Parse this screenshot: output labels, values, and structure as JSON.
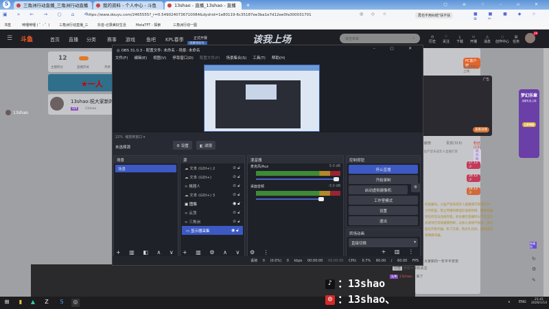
{
  "browser": {
    "tabs": [
      {
        "label": "三角洲行动直播_三角洲行动直播"
      },
      {
        "label": "我的资料 - 个人中心 - 斗鱼"
      },
      {
        "label": "13shao - 直播_13shao - 直播"
      }
    ],
    "new_tab": "+",
    "url": "https://www.douyu.com/2465555?_r=0.5490240736710084&dyshid=1e80119-6c35187ee3ba1e7d12ee0fa300031701",
    "notice": "再也不用纠结\"扶不扶",
    "bookmarks": [
      "书签",
      "啤哩啤哩 ( ゜- ゜)",
      "三角洲行动直播_三",
      "抖音-记录美好生活",
      "MetaTFT - 探索",
      "三角洲行动一图"
    ]
  },
  "site": {
    "logo": "斗鱼",
    "nav": [
      "首页",
      "直播",
      "分类",
      "赛事",
      "游戏",
      "鱼吧",
      "KPL春季"
    ],
    "promo": "正式开赛",
    "promo_sub": "观赛领好礼",
    "banner": "该我上场",
    "search_placeholder": "进击未来",
    "header_icons": [
      "历史",
      "关注",
      "下载",
      "开播",
      "消息",
      "创作中心",
      "任务"
    ],
    "avatar_badge": "39"
  },
  "page": {
    "score": "12",
    "score_label": "主播积分",
    "switch_label": "直播开关",
    "rank_label": "月榜",
    "ad_banner": "★一人",
    "stream_title": "13shao:祝大家新的",
    "streamer": "13shao",
    "level": "1/4",
    "user_side": "13shao",
    "pc_client": "PC客户端",
    "pc_sub": "主播定制已上线",
    "ad_label": "广告",
    "ad_btn": "查看详情",
    "tabs": [
      "贡献榜",
      "贵宾(315)",
      "粉丝(13)"
    ],
    "notice": "斗鱼严禁未成年人直播打赏",
    "become_fan": "成为粉丝",
    "fans": [
      {
        "rank": "27",
        "name": "13少"
      },
      {
        "rank": "26",
        "name": "13少"
      },
      {
        "rank": "26",
        "name": "13少"
      }
    ],
    "warning": "的直播间。斗鱼严禁未成年人直播或打赏进行24小时巡查。禁止传播封建迷信低俗色情、赌博诈骗等任何违法违规内容。如主播在直播时以不正当方式诱导打赏请谨慎判断，以防人身财产损失。请勿轻信代练代抽、私下交易、购买礼包码、游戏道具等网络诈骗。",
    "chat": [
      {
        "text": "大家新的一年平平安安"
      },
      {
        "tag": "公告",
        "text": "谢谢大家的关注"
      },
      {
        "badge": "1/4",
        "user": "13shao、",
        "text": "来了"
      }
    ],
    "side_ad": "梦幻乐章",
    "side_ad_sub": "全新礼包上线",
    "side_ad_btn": "立即领取",
    "side_widget": "有福利"
  },
  "obs": {
    "title": "OBS 31.0.3 - 配置文件: 未命名 - 场景: 未命名",
    "menu": [
      "文件(F)",
      "编辑(E)",
      "视图(V)",
      "停靠窗口(D)",
      "配置文件(P)",
      "场景集合(S)",
      "工具(T)",
      "帮助(H)"
    ],
    "zoom": "22%",
    "zoom_mode": "缩放到窗口",
    "no_source": "未选择源",
    "settings_btn": "设置",
    "filters_btn": "滤镜",
    "scenes_title": "场景",
    "scenes": [
      "场景"
    ],
    "sources_title": "源",
    "sources": [
      {
        "name": "文本 (GDI+) 2",
        "icon": "text"
      },
      {
        "name": "文本 (GDI+)",
        "icon": "text"
      },
      {
        "name": "機器人",
        "icon": "media"
      },
      {
        "name": "文本 (GDI+) 3",
        "icon": "text"
      },
      {
        "name": "图像",
        "icon": "image"
      },
      {
        "name": "云顶",
        "icon": "media"
      },
      {
        "name": "三角洲",
        "icon": "media"
      },
      {
        "name": "显示器采集",
        "icon": "monitor"
      }
    ],
    "mixer_title": "混音器",
    "mixer": [
      {
        "name": "麦克风/Aux",
        "db": "5.0 dB",
        "level": 1.0
      },
      {
        "name": "桌面音频",
        "db": "-3.0 dB",
        "level": 0.84
      }
    ],
    "controls_title": "控制按钮",
    "controls": [
      "停止直播",
      "开始录制",
      "启动虚拟摄像机",
      "工作室模式",
      "设置",
      "退出"
    ],
    "transitions_title": "转场动画",
    "transition": "直接切换",
    "status": [
      "丢帧 0 (0.0%)",
      "0 kbps",
      "00:00:00",
      "00:00:00",
      "CPU: 0.7%",
      "60.00 / 60.00 FPS"
    ]
  },
  "overlay": {
    "douyin": "：13shao",
    "netease": "：13shao、"
  },
  "taskbar": {
    "lang": "ENG",
    "time": "21:41",
    "date": "2026/1/14"
  },
  "colors": {
    "accent": "#3c59c4",
    "douyu": "#ff5d23",
    "obs_bg": "#272a33"
  }
}
